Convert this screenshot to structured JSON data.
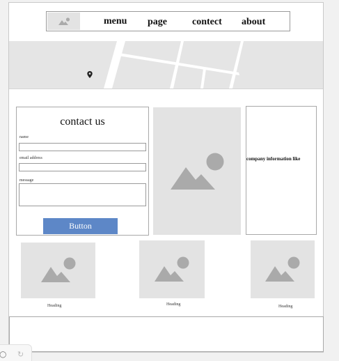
{
  "nav": {
    "items": [
      {
        "id": "menu",
        "label": "menu"
      },
      {
        "id": "page",
        "label": "page"
      },
      {
        "id": "contect",
        "label": "contect"
      },
      {
        "id": "about",
        "label": "about"
      }
    ]
  },
  "map": {
    "pin_icon": "map-pin-icon"
  },
  "contact": {
    "title": "contact us",
    "fields": {
      "name_label": "name",
      "email_label": "email address",
      "message_label": "message"
    },
    "button_label": "Button"
  },
  "info": {
    "text": "company information like"
  },
  "cards": [
    {
      "heading": "Heading"
    },
    {
      "heading": "Heading"
    },
    {
      "heading": "Heading"
    }
  ],
  "icons": {
    "image_placeholder": "image-placeholder-icon"
  },
  "colors": {
    "button": "#5d87c7",
    "placeholder_bg": "#e3e3e3",
    "placeholder_glyph": "#aaaaaa"
  }
}
